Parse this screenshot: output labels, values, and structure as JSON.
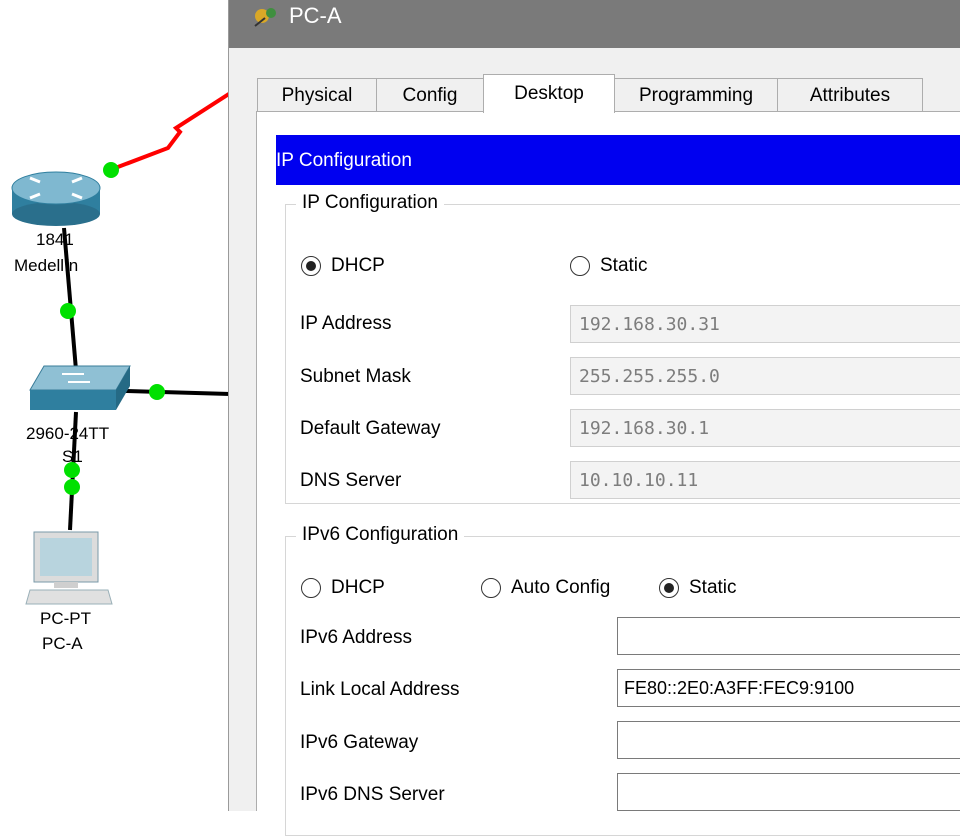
{
  "topology": {
    "router": {
      "model": "1841",
      "name": "Medellín"
    },
    "switch": {
      "model": "2960-24TT",
      "name": "S1"
    },
    "pc": {
      "model": "PC-PT",
      "name": "PC-A"
    },
    "colors": {
      "serial_link": "#ff0000",
      "ethernet_link": "#000000",
      "link_up": "#00e000"
    }
  },
  "window": {
    "title": "PC-A",
    "tabs": [
      {
        "label": "Physical",
        "active": false
      },
      {
        "label": "Config",
        "active": false
      },
      {
        "label": "Desktop",
        "active": true
      },
      {
        "label": "Programming",
        "active": false
      },
      {
        "label": "Attributes",
        "active": false
      }
    ]
  },
  "desktop": {
    "header": "IP Configuration",
    "ipv4": {
      "group_title": "IP Configuration",
      "mode_options": [
        {
          "label": "DHCP",
          "checked": true
        },
        {
          "label": "Static",
          "checked": false
        }
      ],
      "fields": [
        {
          "label": "IP Address",
          "value": "192.168.30.31"
        },
        {
          "label": "Subnet Mask",
          "value": "255.255.255.0"
        },
        {
          "label": "Default Gateway",
          "value": "192.168.30.1"
        },
        {
          "label": "DNS Server",
          "value": "10.10.10.11"
        }
      ]
    },
    "ipv6": {
      "group_title": "IPv6 Configuration",
      "mode_options": [
        {
          "label": "DHCP",
          "checked": false
        },
        {
          "label": "Auto Config",
          "checked": false
        },
        {
          "label": "Static",
          "checked": true
        }
      ],
      "fields": [
        {
          "label": "IPv6 Address",
          "value": ""
        },
        {
          "label": "Link Local Address",
          "value": "FE80::2E0:A3FF:FEC9:9100"
        },
        {
          "label": "IPv6 Gateway",
          "value": ""
        },
        {
          "label": "IPv6 DNS Server",
          "value": ""
        }
      ]
    }
  },
  "colors": {
    "header_bg": "#0000f0",
    "titlebar_bg": "#7a7a7a"
  }
}
